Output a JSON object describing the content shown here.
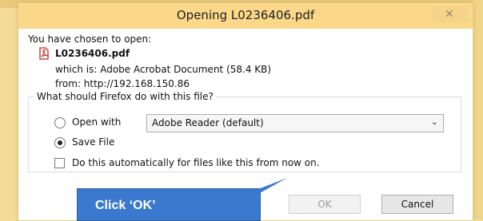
{
  "dialog": {
    "title": "Opening L0236406.pdf",
    "close_glyph": "✕",
    "intro": "You have chosen to open:",
    "file_name": "L0236406.pdf",
    "which_is": "which is:  Adobe Acrobat Document (58.4 KB)",
    "from": "from:  http://192.168.150.86",
    "question": "What should Firefox do with this file?",
    "open_with_label": "Open with",
    "open_with_app": "Adobe Reader  (default)",
    "save_file_label": "Save File",
    "selected_option": "save-file",
    "auto_label": "Do this automatically for files like this from now on.",
    "auto_checked": false,
    "ok_label": "OK",
    "cancel_label": "Cancel"
  },
  "callout": {
    "text": "Click ‘OK’",
    "color": "#3a79cd"
  },
  "icons": {
    "file": "pdf-file-icon",
    "dropdown": "chevron-down-icon",
    "close": "close-icon"
  }
}
